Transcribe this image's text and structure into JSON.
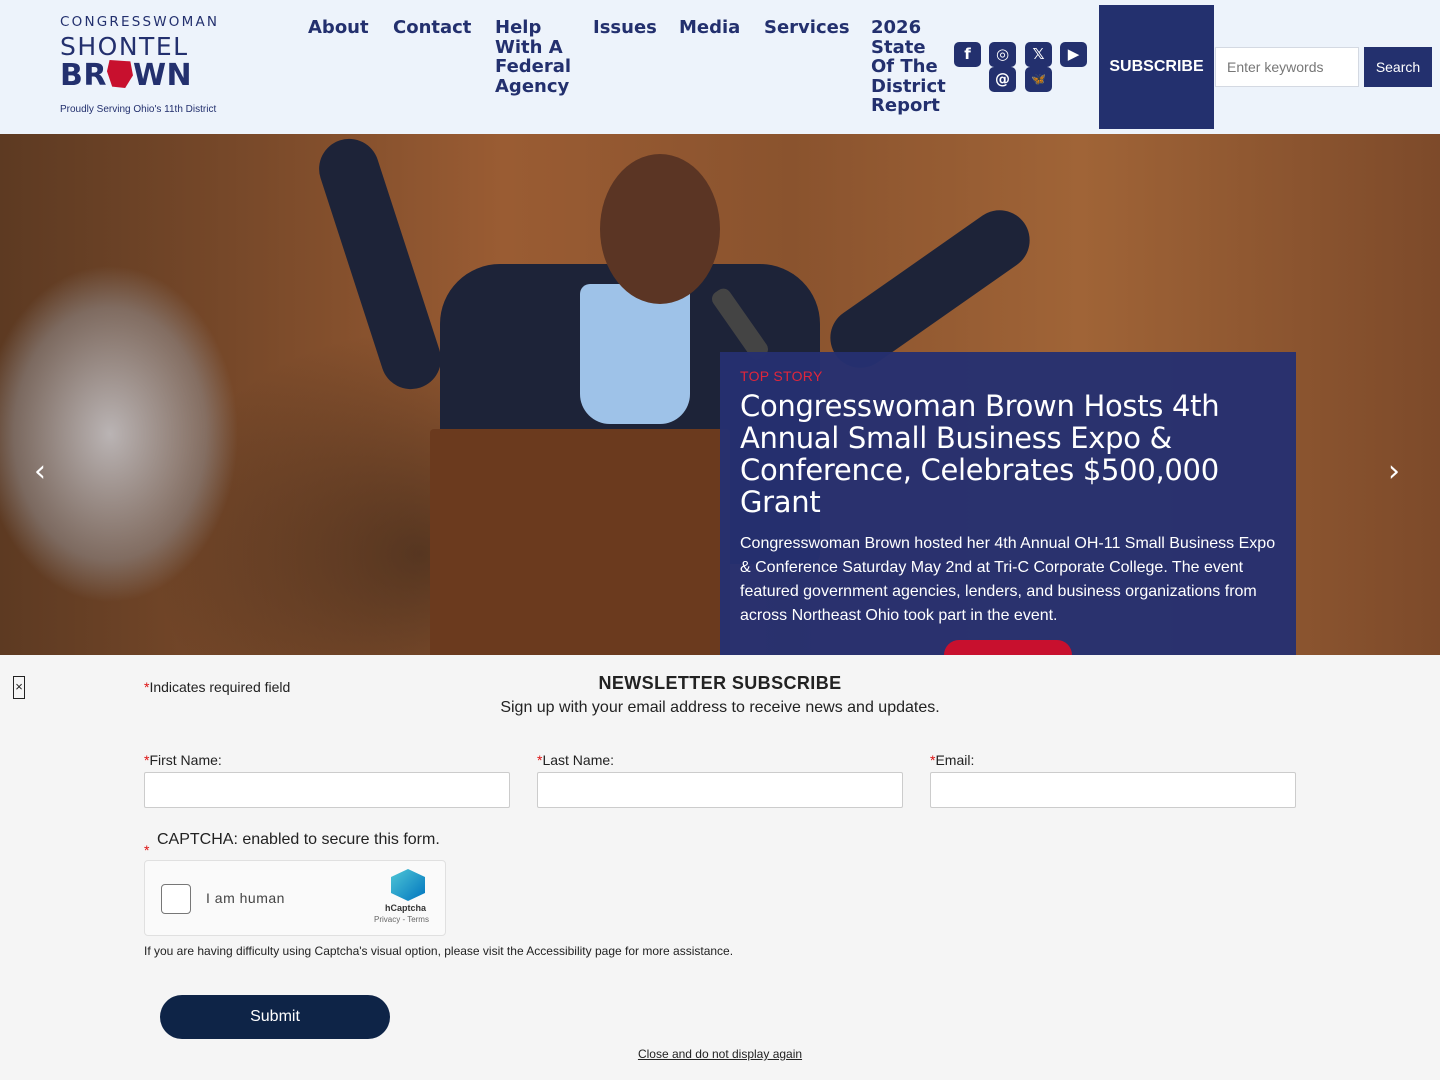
{
  "logo": {
    "line1": "CONGRESSWOMAN",
    "line2": "SHONTEL",
    "line3_a": "BR",
    "line3_b": "WN",
    "tagline": "Proudly Serving Ohio's 11th District"
  },
  "nav": {
    "about": "About",
    "contact": "Contact",
    "help": "Help With A Federal Agency",
    "issues": "Issues",
    "media": "Media",
    "services": "Services",
    "report": "2026 State Of The District Report"
  },
  "social": {
    "facebook": "f",
    "instagram": "◎",
    "x": "𝕏",
    "youtube": "▶",
    "threads": "@",
    "bluesky": "🦋"
  },
  "header": {
    "subscribe_label": "SUBSCRIBE",
    "search_placeholder": "Enter keywords",
    "search_label": "Search"
  },
  "hero": {
    "prev_arrow": "‹",
    "next_arrow": "›",
    "kicker": "TOP STORY",
    "headline": "Congresswoman Brown Hosts 4th Annual Small Business Expo & Conference, Celebrates $500,000 Grant",
    "summary": "Congresswoman Brown hosted her 4th Annual OH-11 Small Business Expo & Conference Saturday May 2nd at Tri-C Corporate College. The event featured government agencies, lenders, and business organizations from across Northeast Ohio took part in the event."
  },
  "newsletter": {
    "close_glyph": "×",
    "required_star": "*",
    "required_note": "Indicates required field",
    "title": "NEWSLETTER SUBSCRIBE",
    "subtitle": "Sign up with your email address to receive news and updates.",
    "first_name_label": "First Name:",
    "last_name_label": "Last Name:",
    "email_label": "Email:",
    "captcha_label": "CAPTCHA: enabled to secure this form.",
    "captcha_checkbox_text": "I am human",
    "captcha_brand": "hCaptcha",
    "captcha_links": "Privacy - Terms",
    "captcha_help": "If you are having difficulty using Captcha's visual option, please visit the Accessibility page for more assistance.",
    "submit_label": "Submit",
    "close_link": "Close and do not display again"
  },
  "colors": {
    "navy": "#23306e",
    "red": "#c8102e",
    "header_bg": "#edf3fb",
    "submit_bg": "#0e2447"
  }
}
